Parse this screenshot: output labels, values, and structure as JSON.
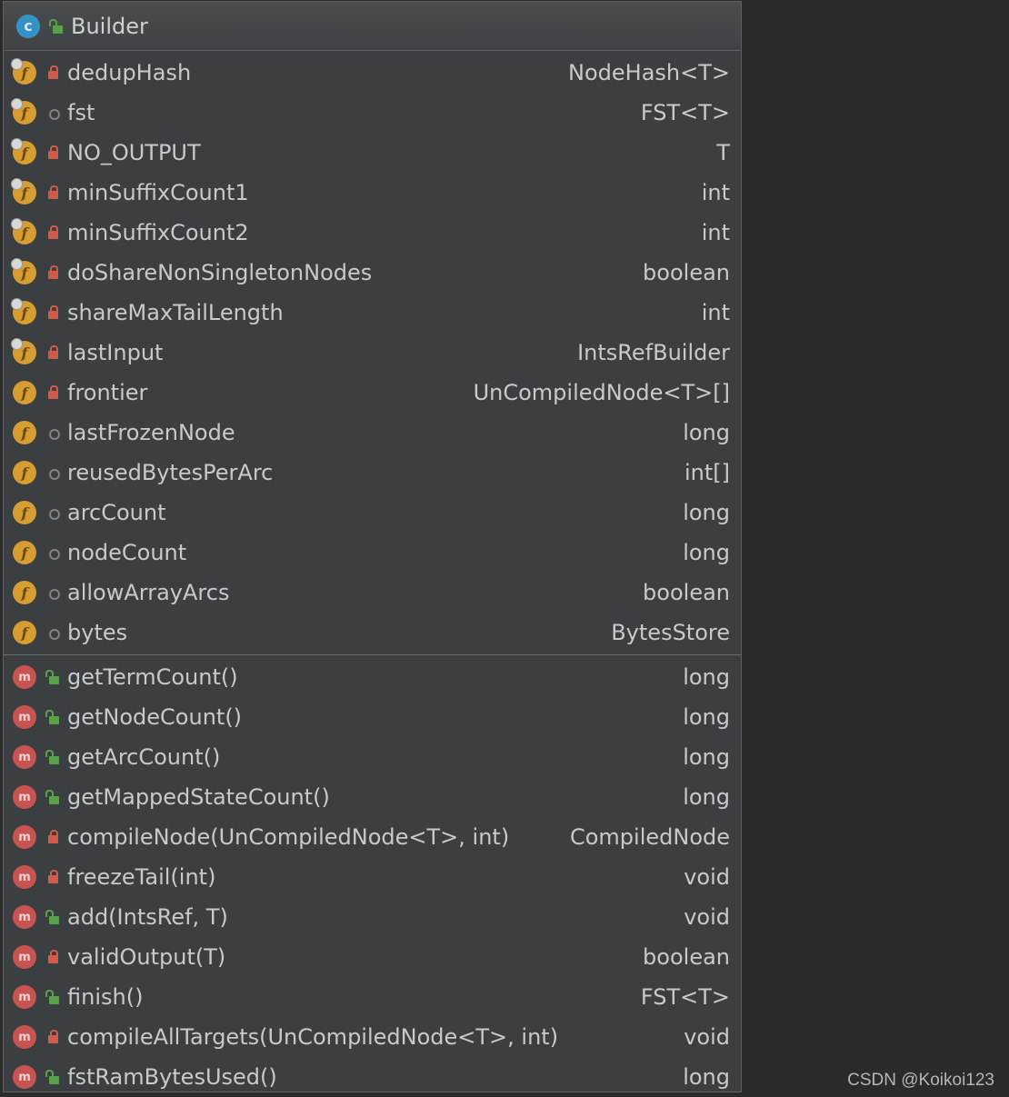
{
  "class": {
    "name": "Builder",
    "kind_icon": "class-icon",
    "visibility_icon": "public-icon"
  },
  "fields": [
    {
      "name": "dedupHash",
      "type": "NodeHash<T>",
      "visibility": "private",
      "final": true
    },
    {
      "name": "fst",
      "type": "FST<T>",
      "visibility": "package",
      "final": true
    },
    {
      "name": "NO_OUTPUT",
      "type": "T",
      "visibility": "private",
      "final": true
    },
    {
      "name": "minSuffixCount1",
      "type": "int",
      "visibility": "private",
      "final": true
    },
    {
      "name": "minSuffixCount2",
      "type": "int",
      "visibility": "private",
      "final": true
    },
    {
      "name": "doShareNonSingletonNodes",
      "type": "boolean",
      "visibility": "private",
      "final": true
    },
    {
      "name": "shareMaxTailLength",
      "type": "int",
      "visibility": "private",
      "final": true
    },
    {
      "name": "lastInput",
      "type": "IntsRefBuilder",
      "visibility": "private",
      "final": true
    },
    {
      "name": "frontier",
      "type": "UnCompiledNode<T>[]",
      "visibility": "private",
      "final": false
    },
    {
      "name": "lastFrozenNode",
      "type": "long",
      "visibility": "package",
      "final": false
    },
    {
      "name": "reusedBytesPerArc",
      "type": "int[]",
      "visibility": "package",
      "final": false
    },
    {
      "name": "arcCount",
      "type": "long",
      "visibility": "package",
      "final": false
    },
    {
      "name": "nodeCount",
      "type": "long",
      "visibility": "package",
      "final": false
    },
    {
      "name": "allowArrayArcs",
      "type": "boolean",
      "visibility": "package",
      "final": false
    },
    {
      "name": "bytes",
      "type": "BytesStore",
      "visibility": "package",
      "final": false
    }
  ],
  "methods": [
    {
      "name": "getTermCount()",
      "type": "long",
      "visibility": "public"
    },
    {
      "name": "getNodeCount()",
      "type": "long",
      "visibility": "public"
    },
    {
      "name": "getArcCount()",
      "type": "long",
      "visibility": "public"
    },
    {
      "name": "getMappedStateCount()",
      "type": "long",
      "visibility": "public"
    },
    {
      "name": "compileNode(UnCompiledNode<T>, int)",
      "type": "CompiledNode",
      "visibility": "private"
    },
    {
      "name": "freezeTail(int)",
      "type": "void",
      "visibility": "private"
    },
    {
      "name": "add(IntsRef, T)",
      "type": "void",
      "visibility": "public"
    },
    {
      "name": "validOutput(T)",
      "type": "boolean",
      "visibility": "private"
    },
    {
      "name": "finish()",
      "type": "FST<T>",
      "visibility": "public"
    },
    {
      "name": "compileAllTargets(UnCompiledNode<T>, int)",
      "type": "void",
      "visibility": "private"
    },
    {
      "name": "fstRamBytesUsed()",
      "type": "long",
      "visibility": "public"
    }
  ],
  "badges": {
    "class": "c",
    "field": "f",
    "method": "m"
  },
  "watermark": "CSDN @Koikoi123",
  "colors": {
    "background": "#2b2b2b",
    "panel": "#3c3f41",
    "class_badge": "#3592c4",
    "field_badge": "#d69d33",
    "method_badge": "#c75450",
    "private_lock": "#d05b48",
    "public_lock": "#5aa04b",
    "text": "#c9c9c9"
  }
}
